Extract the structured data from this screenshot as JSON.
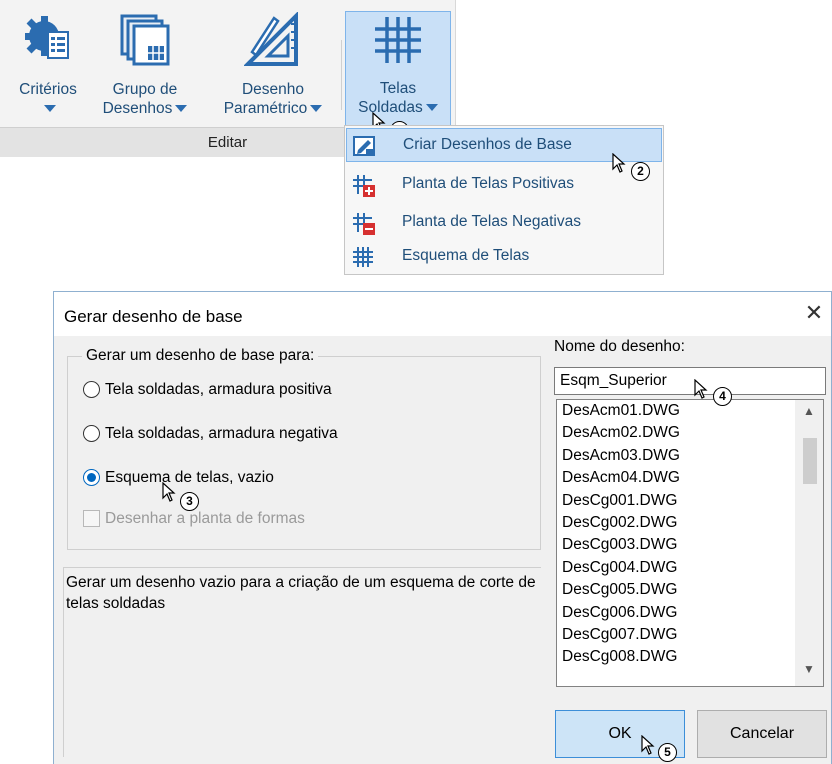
{
  "ribbon": {
    "buttons": [
      {
        "label1": "Critérios",
        "label2": ""
      },
      {
        "label1": "Grupo de",
        "label2": "Desenhos"
      },
      {
        "label1": "Desenho",
        "label2": "Paramétrico"
      },
      {
        "label1": "Telas",
        "label2": "Soldadas"
      }
    ],
    "group_label": "Editar"
  },
  "menu": {
    "items": [
      {
        "label": "Criar Desenhos de Base",
        "icon": "create-base-drawing-icon",
        "highlighted": true
      },
      {
        "label": "Planta de Telas Positivas",
        "icon": "mesh-positive-icon"
      },
      {
        "label": "Planta de Telas Negativas",
        "icon": "mesh-negative-icon"
      },
      {
        "label": "Esquema de Telas",
        "icon": "mesh-grid-icon"
      }
    ]
  },
  "dialog": {
    "title": "Gerar desenho de base",
    "group_legend": "Gerar um desenho de base para:",
    "options": [
      {
        "label": "Tela soldadas, armadura positiva",
        "selected": false
      },
      {
        "label": "Tela soldadas, armadura negativa",
        "selected": false
      },
      {
        "label": "Esquema de telas, vazio",
        "selected": true
      }
    ],
    "checkbox_label": "Desenhar a planta de formas",
    "description": "Gerar um desenho vazio para a criação de um esquema de corte de telas soldadas",
    "name_label": "Nome do desenho:",
    "name_value": "Esqm_Superior",
    "files": [
      "DesAcm01.DWG",
      "DesAcm02.DWG",
      "DesAcm03.DWG",
      "DesAcm04.DWG",
      "DesCg001.DWG",
      "DesCg002.DWG",
      "DesCg003.DWG",
      "DesCg004.DWG",
      "DesCg005.DWG",
      "DesCg006.DWG",
      "DesCg007.DWG",
      "DesCg008.DWG"
    ],
    "ok_label": "OK",
    "cancel_label": "Cancelar"
  },
  "callouts": [
    "1",
    "2",
    "3",
    "4",
    "5"
  ],
  "colors": {
    "accent": "#1f4e79",
    "highlight": "#c9e0f7",
    "radio": "#0067c0"
  }
}
